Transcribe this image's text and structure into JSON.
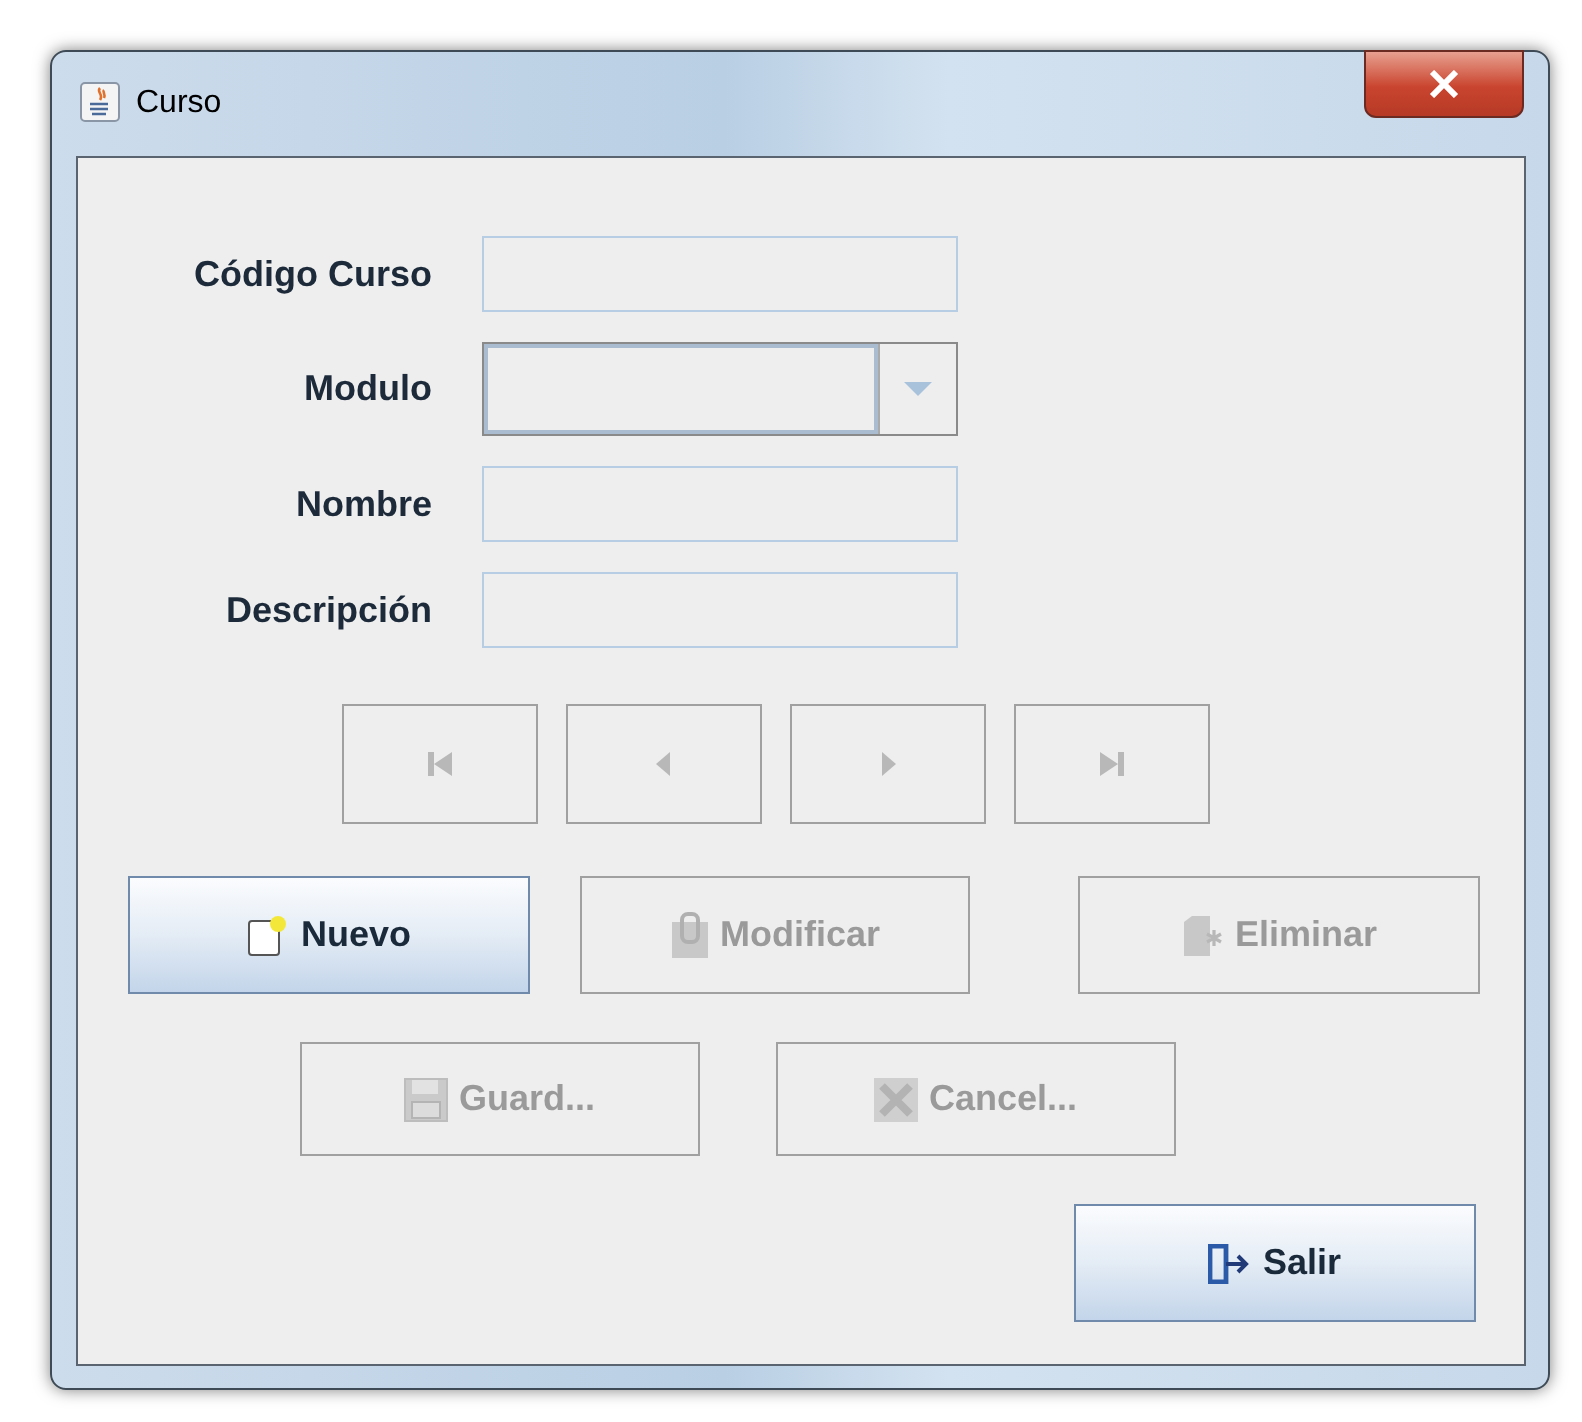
{
  "window": {
    "title": "Curso"
  },
  "fields": [
    {
      "kind": "text",
      "label": "Código Curso"
    },
    {
      "kind": "combo",
      "label": "Modulo"
    },
    {
      "kind": "text",
      "label": "Nombre"
    },
    {
      "kind": "text",
      "label": "Descripción"
    }
  ],
  "navigation": [
    {
      "kind": "first",
      "disabled": true
    },
    {
      "kind": "prev",
      "disabled": true
    },
    {
      "kind": "next",
      "disabled": true
    },
    {
      "kind": "last",
      "disabled": true
    }
  ],
  "action_rows": [
    [
      {
        "label": "Nuevo",
        "kind": "new",
        "disabled": false
      },
      {
        "label": "Modificar",
        "kind": "edit",
        "disabled": true
      },
      {
        "label": "Eliminar",
        "kind": "delete",
        "disabled": true
      }
    ],
    [
      {
        "label": "Guard...",
        "kind": "save",
        "disabled": true
      },
      {
        "label": "Cancel...",
        "kind": "cancel",
        "disabled": true
      }
    ],
    [
      {
        "label": "Salir",
        "kind": "exit",
        "disabled": false
      }
    ]
  ]
}
